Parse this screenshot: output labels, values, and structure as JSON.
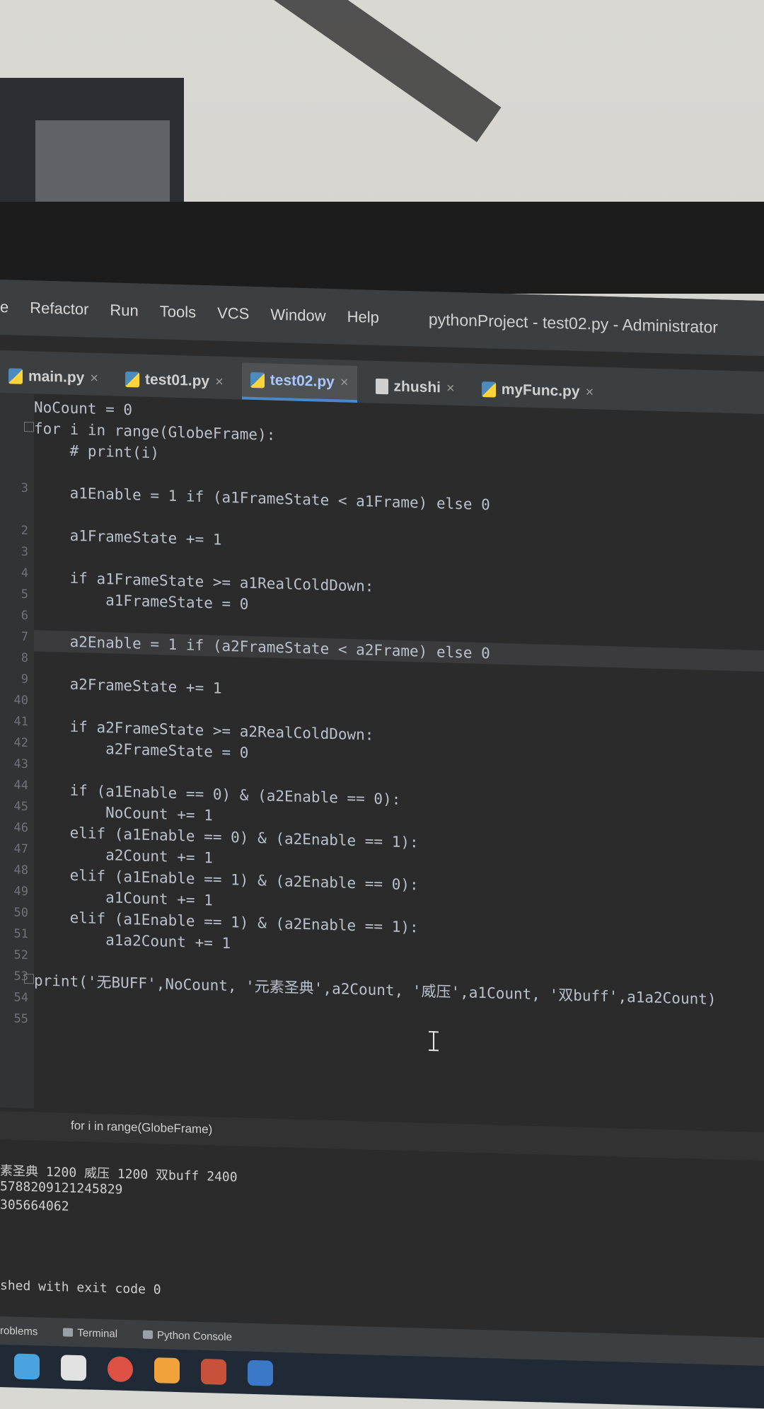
{
  "menu": {
    "items": [
      "e",
      "Refactor",
      "Run",
      "Tools",
      "VCS",
      "Window",
      "Help"
    ],
    "title": "pythonProject - test02.py - Administrator"
  },
  "tabs": [
    {
      "label": "main.py",
      "icon": "python-file-icon",
      "active": false
    },
    {
      "label": "test01.py",
      "icon": "python-file-icon",
      "active": false
    },
    {
      "label": "test02.py",
      "icon": "python-file-icon",
      "active": true
    },
    {
      "label": "zhushi",
      "icon": "text-file-icon",
      "active": false
    },
    {
      "label": "myFunc.py",
      "icon": "python-file-icon",
      "active": false
    }
  ],
  "gutter": {
    "lines": [
      "3",
      "2",
      "3",
      "4",
      "5",
      "6",
      "7",
      "8",
      "9",
      "40",
      "41",
      "42",
      "43",
      "44",
      "45",
      "46",
      "47",
      "48",
      "49",
      "50",
      "51",
      "52",
      "53",
      "54",
      "55"
    ]
  },
  "code": [
    "NoCount = 0",
    "for i in range(GlobeFrame):",
    "    # print(i)",
    "",
    "    a1Enable = 1 if (a1FrameState < a1Frame) else 0",
    "",
    "    a1FrameState += 1",
    "",
    "    if a1FrameState >= a1RealColdDown:",
    "        a1FrameState = 0",
    "",
    "    a2Enable = 1 if (a2FrameState < a2Frame) else 0",
    "",
    "    a2FrameState += 1",
    "",
    "    if a2FrameState >= a2RealColdDown:",
    "        a2FrameState = 0",
    "",
    "    if (a1Enable == 0) & (a2Enable == 0):",
    "        NoCount += 1",
    "    elif (a1Enable == 0) & (a2Enable == 1):",
    "        a2Count += 1",
    "    elif (a1Enable == 1) & (a2Enable == 0):",
    "        a1Count += 1",
    "    elif (a1Enable == 1) & (a2Enable == 1):",
    "        a1a2Count += 1",
    "",
    "print('无BUFF',NoCount, '元素圣典',a2Count, '威压',a1Count, '双buff',a1a2Count)"
  ],
  "breadcrumb": "for i in range(GlobeFrame)",
  "console": [
    "素圣典 1200 威压 1200 双buff 2400",
    "5788209121245829",
    "305664062",
    "",
    "",
    "",
    "shed with exit code 0"
  ],
  "toolwindows": [
    "roblems",
    "Terminal",
    "Python Console"
  ]
}
